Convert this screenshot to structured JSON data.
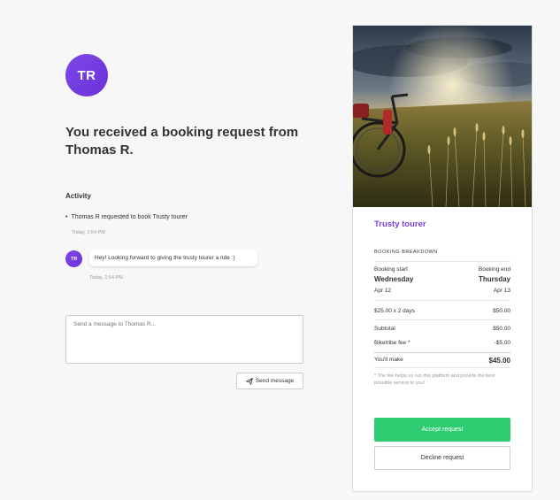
{
  "requester": {
    "initials": "TR",
    "headline": "You received a booking request from Thomas R."
  },
  "activity": {
    "title": "Activity",
    "event": "Thomas R requested to book Trusty tourer",
    "event_time": "Today, 1:54 PM",
    "message_avatar": "TR",
    "message": "Hey! Looking forward to giving the trusty tourer a ride :)",
    "message_time": "Today, 1:54 PM"
  },
  "compose": {
    "placeholder": "Send a message to Thomas R...",
    "send_label": "Send message",
    "send_icon": "paper-plane-icon"
  },
  "listing": {
    "name": "Trusty tourer",
    "breakdown_title": "BOOKING BREAKDOWN",
    "start_label": "Booking start",
    "end_label": "Booking end",
    "start_day": "Wednesday",
    "end_day": "Thursday",
    "start_date": "Apr 12",
    "end_date": "Apr 13",
    "rate_label": "$25.00 x 2 days",
    "rate_value": "$50.00",
    "subtotal_label": "Subtotal",
    "subtotal_value": "$50.00",
    "fee_label": "Biketribe fee *",
    "fee_value": "-$5.00",
    "total_label": "You'll make",
    "total_value": "$45.00",
    "fee_note": "* The fee helps us run this platform and provide the best possible service to you!",
    "accept_label": "Accept request",
    "decline_label": "Decline request"
  },
  "colors": {
    "brand_purple": "#7b3fe4",
    "accept_green": "#2ecc71"
  }
}
